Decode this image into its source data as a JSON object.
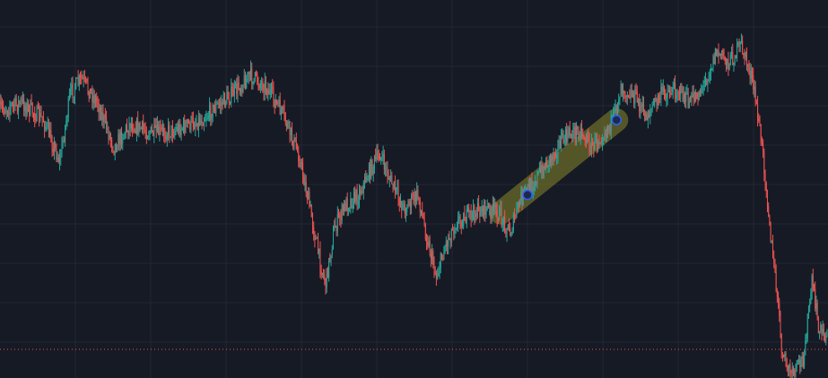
{
  "theme": {
    "background": "#161a25",
    "grid": "#232734",
    "up": "#26a69a",
    "down": "#ef5350",
    "highlighter": "#6b6a2a",
    "anchor_fill": "#1e2a4a",
    "anchor_stroke": "#2962ff",
    "price_line": "#ef5350"
  },
  "chart_data": {
    "type": "candlestick",
    "grid": true,
    "count": 760,
    "seed": 7,
    "price_line_level": 0.0,
    "waypoints": [
      [
        0,
        0.27
      ],
      [
        20,
        0.25
      ],
      [
        40,
        0.3
      ],
      [
        55,
        0.42
      ],
      [
        65,
        0.22
      ],
      [
        75,
        0.18
      ],
      [
        90,
        0.25
      ],
      [
        105,
        0.38
      ],
      [
        120,
        0.31
      ],
      [
        140,
        0.34
      ],
      [
        160,
        0.33
      ],
      [
        185,
        0.3
      ],
      [
        200,
        0.26
      ],
      [
        215,
        0.22
      ],
      [
        230,
        0.17
      ],
      [
        245,
        0.2
      ],
      [
        260,
        0.28
      ],
      [
        275,
        0.4
      ],
      [
        285,
        0.55
      ],
      [
        295,
        0.72
      ],
      [
        300,
        0.78
      ],
      [
        308,
        0.62
      ],
      [
        318,
        0.55
      ],
      [
        330,
        0.52
      ],
      [
        342,
        0.44
      ],
      [
        350,
        0.4
      ],
      [
        360,
        0.48
      ],
      [
        372,
        0.56
      ],
      [
        385,
        0.52
      ],
      [
        393,
        0.64
      ],
      [
        402,
        0.76
      ],
      [
        410,
        0.67
      ],
      [
        420,
        0.6
      ],
      [
        432,
        0.58
      ],
      [
        445,
        0.56
      ],
      [
        458,
        0.57
      ],
      [
        470,
        0.63
      ],
      [
        480,
        0.53
      ],
      [
        492,
        0.48
      ],
      [
        505,
        0.42
      ],
      [
        515,
        0.37
      ],
      [
        525,
        0.34
      ],
      [
        535,
        0.33
      ],
      [
        545,
        0.38
      ],
      [
        555,
        0.34
      ],
      [
        565,
        0.3
      ],
      [
        572,
        0.2
      ],
      [
        585,
        0.23
      ],
      [
        595,
        0.29
      ],
      [
        610,
        0.22
      ],
      [
        625,
        0.21
      ],
      [
        635,
        0.25
      ],
      [
        648,
        0.2
      ],
      [
        660,
        0.1
      ],
      [
        672,
        0.13
      ],
      [
        683,
        0.08
      ],
      [
        692,
        0.17
      ],
      [
        698,
        0.28
      ],
      [
        705,
        0.46
      ],
      [
        710,
        0.64
      ],
      [
        716,
        0.82
      ],
      [
        721,
        1.0
      ],
      [
        730,
        1.05
      ],
      [
        740,
        1.0
      ],
      [
        748,
        0.78
      ],
      [
        755,
        0.92
      ],
      [
        762,
        0.93
      ]
    ],
    "highlight": {
      "from": [
        486,
        0.52
      ],
      "to": [
        568,
        0.3
      ]
    }
  }
}
